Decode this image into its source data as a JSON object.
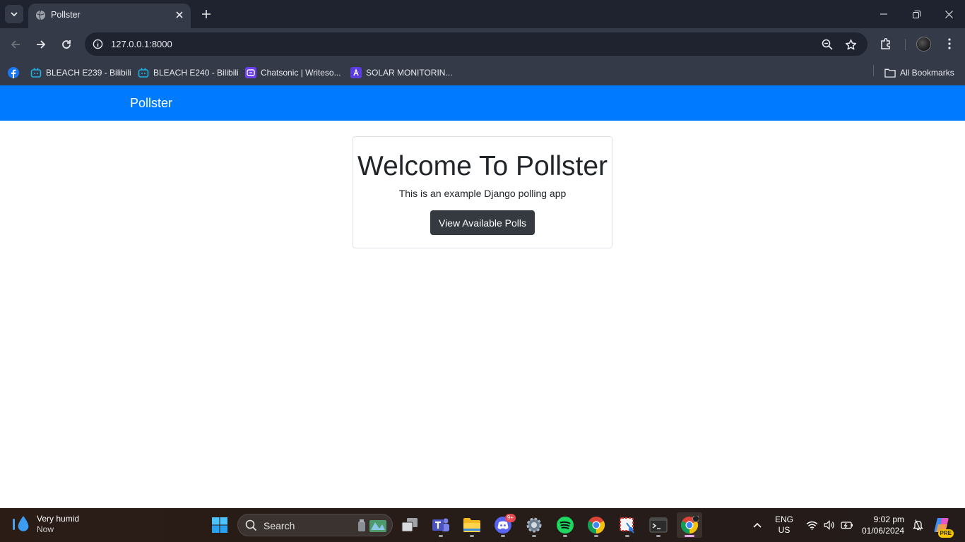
{
  "browser": {
    "tab": {
      "title": "Pollster"
    },
    "address": {
      "url": "127.0.0.1:8000"
    },
    "bookmarks": [
      {
        "label": "BLEACH E239 - Bilibili",
        "icon": "bilibili-icon"
      },
      {
        "label": "BLEACH E240 - Bilibili",
        "icon": "bilibili-icon"
      },
      {
        "label": "Chatsonic | Writeso...",
        "icon": "chatsonic-icon"
      },
      {
        "label": "SOLAR MONITORIN...",
        "icon": "solar-icon"
      }
    ],
    "all_bookmarks_label": "All Bookmarks"
  },
  "page": {
    "navbar": {
      "brand": "Pollster",
      "color": "#007bff"
    },
    "jumbotron": {
      "title": "Welcome To Pollster",
      "subtitle": "This is an example Django polling app",
      "button_label": "View Available Polls"
    }
  },
  "taskbar": {
    "weather": {
      "condition": "Very humid",
      "time": "Now"
    },
    "search_label": "Search",
    "discord_badge": "9+",
    "language": {
      "line1": "ENG",
      "line2": "US"
    },
    "clock": {
      "time": "9:02 pm",
      "date": "01/06/2024"
    },
    "copilot_badge": "PRE"
  }
}
